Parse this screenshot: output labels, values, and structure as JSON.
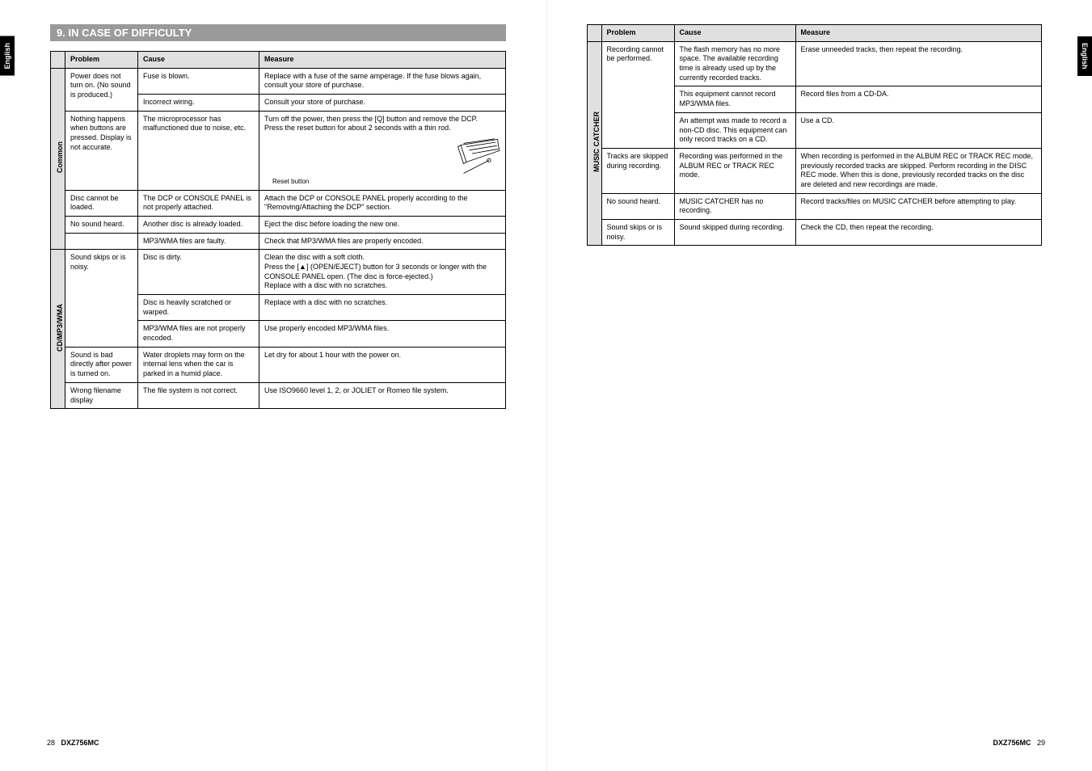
{
  "language_tab": "English",
  "section_title": "9. IN CASE OF DIFFICULTY",
  "headers": {
    "problem": "Problem",
    "cause": "Cause",
    "measure": "Measure"
  },
  "groups": {
    "common": "Common",
    "cd_mp3_wma": "CD/MP3/WMA",
    "music_catcher": "MUSIC CATCHER"
  },
  "reset_label": "Reset button",
  "left_table": {
    "common": [
      {
        "problem": "Power does not turn on. (No sound is produced.)",
        "rows": [
          {
            "cause": "Fuse is blown.",
            "measure": "Replace with a fuse of the same amperage. If the fuse blows again, consult your store of purchase."
          },
          {
            "cause": "Incorrect wiring.",
            "measure": "Consult your store of purchase."
          }
        ]
      },
      {
        "problem": "Nothing happens when buttons are pressed.\nDisplay is not accurate.",
        "rows": [
          {
            "cause": "The microprocessor has malfunctioned due to noise, etc.",
            "measure": "Turn off the power, then press the [Q] button and remove the DCP.\nPress the reset button for about 2 seconds with a thin rod.",
            "has_reset_svg": true
          }
        ]
      },
      {
        "problem": "Disc cannot be loaded.",
        "rows": [
          {
            "cause": "The DCP or CONSOLE PANEL is not properly attached.",
            "measure": "Attach the DCP or CONSOLE PANEL properly according to the \"Removing/Attaching the DCP\" section."
          }
        ]
      },
      {
        "problem": "No sound heard.",
        "rows": [
          {
            "cause": "Another disc is already loaded.",
            "measure": "Eject the disc before loading the new one."
          }
        ]
      },
      {
        "problem": "",
        "rows": [
          {
            "cause": "MP3/WMA files are faulty.",
            "measure": "Check that MP3/WMA files are properly encoded."
          }
        ]
      }
    ],
    "cd": [
      {
        "problem": "Sound skips or is noisy.",
        "rows": [
          {
            "cause": "Disc is dirty.",
            "measure_html": "Clean the disc with a soft cloth.\nPress the [<span class=\"eject\">▲</span>] (OPEN/EJECT) button for 3 seconds or longer with the CONSOLE PANEL open. (The disc is force-ejected.)\nReplace with a disc with no scratches."
          },
          {
            "cause": "Disc is heavily scratched or warped.",
            "measure": "Replace with a disc with no scratches."
          },
          {
            "cause": "MP3/WMA files are not properly encoded.",
            "measure": "Use properly encoded MP3/WMA files."
          }
        ]
      },
      {
        "problem": "Sound is bad directly after power is turned on.",
        "rows": [
          {
            "cause": "Water droplets may form on the internal lens when the car is parked in a humid place.",
            "measure": "Let dry for about 1 hour with the power on."
          }
        ]
      },
      {
        "problem": "Wrong filename display",
        "rows": [
          {
            "cause": "The file system is not correct.",
            "measure": "Use ISO9660 level 1, 2, or JOLIET or Romeo file system."
          }
        ]
      }
    ]
  },
  "right_table": {
    "music_catcher": [
      {
        "problem": "Recording cannot be performed.",
        "rows": [
          {
            "cause": "The flash memory has no more space. The available recording time is already used up by the currently recorded tracks.",
            "measure": "Erase unneeded tracks, then repeat the recording."
          },
          {
            "cause": "This equipment cannot record MP3/WMA files.",
            "measure": "Record files from a CD-DA."
          },
          {
            "cause": "An attempt was made to record a non-CD disc. This equipment can only record tracks on a CD.",
            "measure": "Use a CD."
          }
        ]
      },
      {
        "problem": "Tracks are skipped during recording.",
        "rows": [
          {
            "cause": "Recording was performed in the ALBUM REC or TRACK REC mode.",
            "measure": "When recording is performed in the ALBUM REC or TRACK REC mode, previously recorded tracks are skipped. Perform recording in the DISC REC mode. When this is done, previously recorded tracks on the disc are deleted and new recordings are made."
          }
        ]
      },
      {
        "problem": "No sound heard.",
        "rows": [
          {
            "cause": "MUSIC CATCHER has no recording.",
            "measure": "Record tracks/files on MUSIC CATCHER before attempting to play."
          }
        ]
      },
      {
        "problem": "Sound skips or is noisy.",
        "rows": [
          {
            "cause": "Sound skipped during recording.",
            "measure": "Check the CD, then repeat the recording."
          }
        ]
      }
    ]
  },
  "footer": {
    "left_page": "28",
    "right_page": "29",
    "model": "DXZ756MC"
  }
}
